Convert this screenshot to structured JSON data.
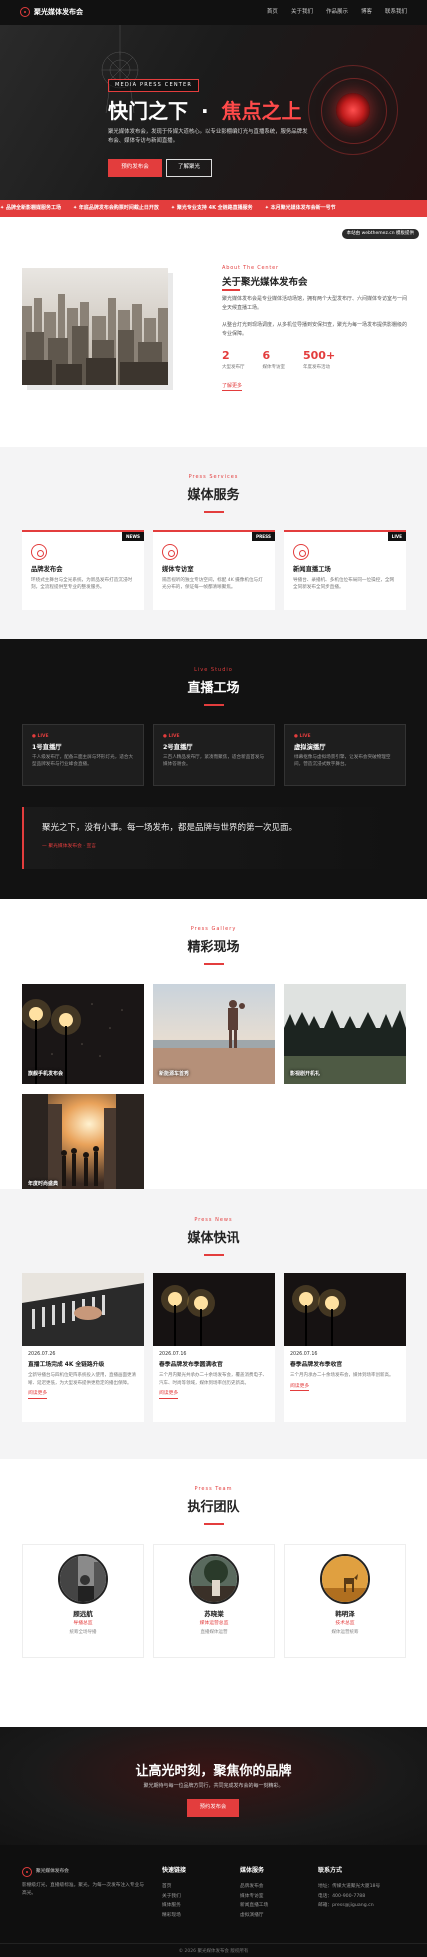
{
  "header": {
    "brand": "聚光媒体发布会",
    "nav": [
      "首页",
      "关于我们",
      "作品展示",
      "博客",
      "联系我们"
    ]
  },
  "hero": {
    "badge": "MEDIA PRESS CENTER",
    "title_a": "快门之下",
    "title_dot": "·",
    "title_b": "焦点之上",
    "desc": "聚光媒体发布会，发现于传媒大道核心。以专业影棚编灯光与直播系统，服务品牌发布会、媒体专访与新闻直播。",
    "btn_primary": "预约发布会",
    "btn_secondary": "了解聚光"
  },
  "ticker": [
    "品牌全新影棚媒服务工场",
    "年底品牌发布会购票时间截止日开放",
    "聚光专业支持 4K 全链路直播服务",
    "本月聚光媒体发布会新一号节"
  ],
  "about": {
    "watermark": "本站由 webthemez.cn 模板提供",
    "eyebrow": "About The Center",
    "title": "关于聚光媒体发布会",
    "p1": "聚光媒体发布会是专业媒体活动场馆，拥有两个大型发布厅、六间媒体专访室与一间全天候直播工场。",
    "p2": "从整合灯光到现场调度，从多机位导播到安保扫查，聚光为每一场发布提供影棚级的专业保障。",
    "stats": [
      {
        "value": "2",
        "label": "大型发布厅"
      },
      {
        "value": "6",
        "label": "媒体专访室"
      },
      {
        "value": "500+",
        "label": "年度发布活动"
      }
    ],
    "more": "了解更多"
  },
  "services": {
    "eyebrow": "Press Services",
    "title": "媒体服务",
    "cards": [
      {
        "tag": "NEWS",
        "title": "品牌发布会",
        "desc": "环绕式主舞台与全光系统，为新品发布打造沉浸时刻，全流程提供至专业的整发服务。"
      },
      {
        "tag": "PRESS",
        "title": "媒体专访室",
        "desc": "隔音视听的独立专访空间，标配 4K 摄像机位与灯光分布的，保证每一帧都清晰聚焦。"
      },
      {
        "tag": "LIVE",
        "title": "新闻直播工场",
        "desc": "导播台、录播机、多机位位布局同一位操控，全网全同新发布全同步直播。"
      }
    ]
  },
  "live": {
    "eyebrow": "Live Studio",
    "title": "直播工场",
    "cards": [
      {
        "tag": "LIVE",
        "title": "1号直播厅",
        "desc": "千人级发布厅，配备三面主屏与环形灯光，适合大型品牌发布与行业峰会直播。"
      },
      {
        "tag": "LIVE",
        "title": "2号直播厅",
        "desc": "三百人精品发布厅，紧凑而聚焦，适合新品首发与媒体答谢会。"
      },
      {
        "tag": "LIVE",
        "title": "虚拟演播厅",
        "desc": "绿幕抠像与虚拟场景引擎，让发布会突破物理空间，营造沉浸式数字舞台。"
      }
    ],
    "quote": "聚光之下，没有小事。每一场发布，都是品牌与世界的第一次见面。",
    "quote_by": "— 聚光媒体发布会 · 宣言"
  },
  "gallery": {
    "eyebrow": "Press Gallery",
    "title": "精彩现场",
    "items": [
      "旗舰手机发布会",
      "新能源车首秀",
      "影视剧开机礼",
      "年度时尚盛典"
    ]
  },
  "news": {
    "eyebrow": "Press News",
    "title": "媒体快讯",
    "items": [
      {
        "date": "2026.07.26",
        "title": "直播工场完成 4K 全链路升级",
        "desc": "全新导播台与四机位矩阵系统投入使用，直播画面更清晰、延迟更低，为大型发布提供更稳定的播出保障。",
        "more": "阅读更多"
      },
      {
        "date": "2026.07.16",
        "title": "春季品牌发布季圆满收官",
        "desc": "三个月内聚光共承办二十余场发布会，覆盖消费电子、汽车、时尚等领域，媒体到场率创历史新高。",
        "more": "阅读更多"
      },
      {
        "date": "2026.07.16",
        "title": "春季品牌发布季收官",
        "desc": "三个月内承办二十余场发布会，媒体到场率创新高。",
        "more": "阅读更多"
      }
    ]
  },
  "team": {
    "eyebrow": "Press Team",
    "title": "执行团队",
    "members": [
      {
        "name": "顾远航",
        "role": "导播总监",
        "bio": "统筹全场导播"
      },
      {
        "name": "苏晓棠",
        "role": "媒体运营总监",
        "bio": "直播媒体运营"
      },
      {
        "name": "韩明泽",
        "role": "技术总监",
        "bio": "媒体运营统筹"
      }
    ]
  },
  "cta": {
    "title": "让高光时刻，聚焦你的品牌",
    "desc": "聚光期待与每一位品牌方同行，共同完成发布会的每一刻精彩。",
    "button": "预约发布会"
  },
  "footer": {
    "brand": "聚光媒体发布会",
    "desc": "影棚级灯光，直播级标准。聚光，为每一次发布注入专业与高光。",
    "col1_title": "快速链接",
    "col1": [
      "首页",
      "关于我们",
      "媒体服务",
      "精彩现场"
    ],
    "col2_title": "媒体服务",
    "col2": [
      "品牌发布会",
      "媒体专访室",
      "新闻直播工场",
      "虚拟演播厅"
    ],
    "col3_title": "联系方式",
    "col3": [
      "地址：传媒大道聚光大厦18号",
      "电话：400-900-7788",
      "邮箱：press@jiguang.cn"
    ],
    "copyright": "© 2026 聚光媒体发布会 版权所有"
  },
  "colors": {
    "accent": "#e33d3d",
    "dark": "#121212",
    "light": "#f4f4f5"
  }
}
